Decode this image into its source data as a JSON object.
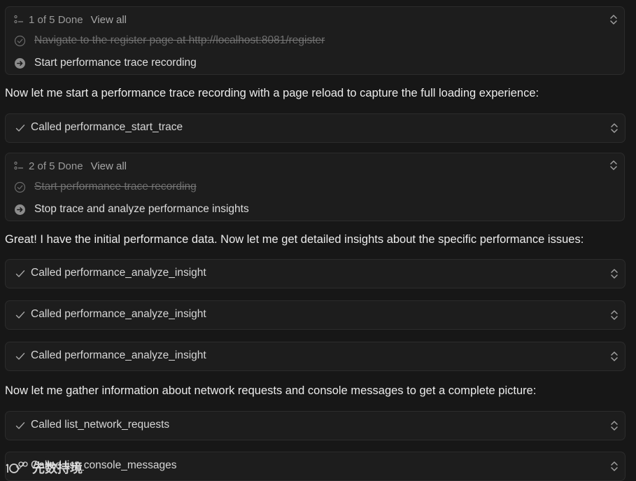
{
  "todo1": {
    "summary": "1 of 5 Done",
    "view_all": "View all",
    "items": [
      {
        "text": "Navigate to the register page at http://localhost:8081/register",
        "status": "done"
      },
      {
        "text": "Start performance trace recording",
        "status": "in-progress"
      }
    ]
  },
  "msg1": "Now let me start a performance trace recording with a page reload to capture the full loading experience:",
  "tool1": "Called performance_start_trace",
  "todo2": {
    "summary": "2 of 5 Done",
    "view_all": "View all",
    "items": [
      {
        "text": "Start performance trace recording",
        "status": "done"
      },
      {
        "text": "Stop trace and analyze performance insights",
        "status": "in-progress"
      }
    ]
  },
  "msg2": "Great! I have the initial performance data. Now let me get detailed insights about the specific performance issues:",
  "tool2": "Called performance_analyze_insight",
  "tool3": "Called performance_analyze_insight",
  "tool4": "Called performance_analyze_insight",
  "msg3": "Now let me gather information about network requests and console messages to get a complete picture:",
  "tool5": "Called list_network_requests",
  "tool6": "Called list_console_messages",
  "watermark": "先数持境",
  "colors": {
    "background": "#171717",
    "card": "#1d1d1d",
    "border": "#2c2c2c",
    "text": "#ececec",
    "muted": "#9a9a9a"
  }
}
